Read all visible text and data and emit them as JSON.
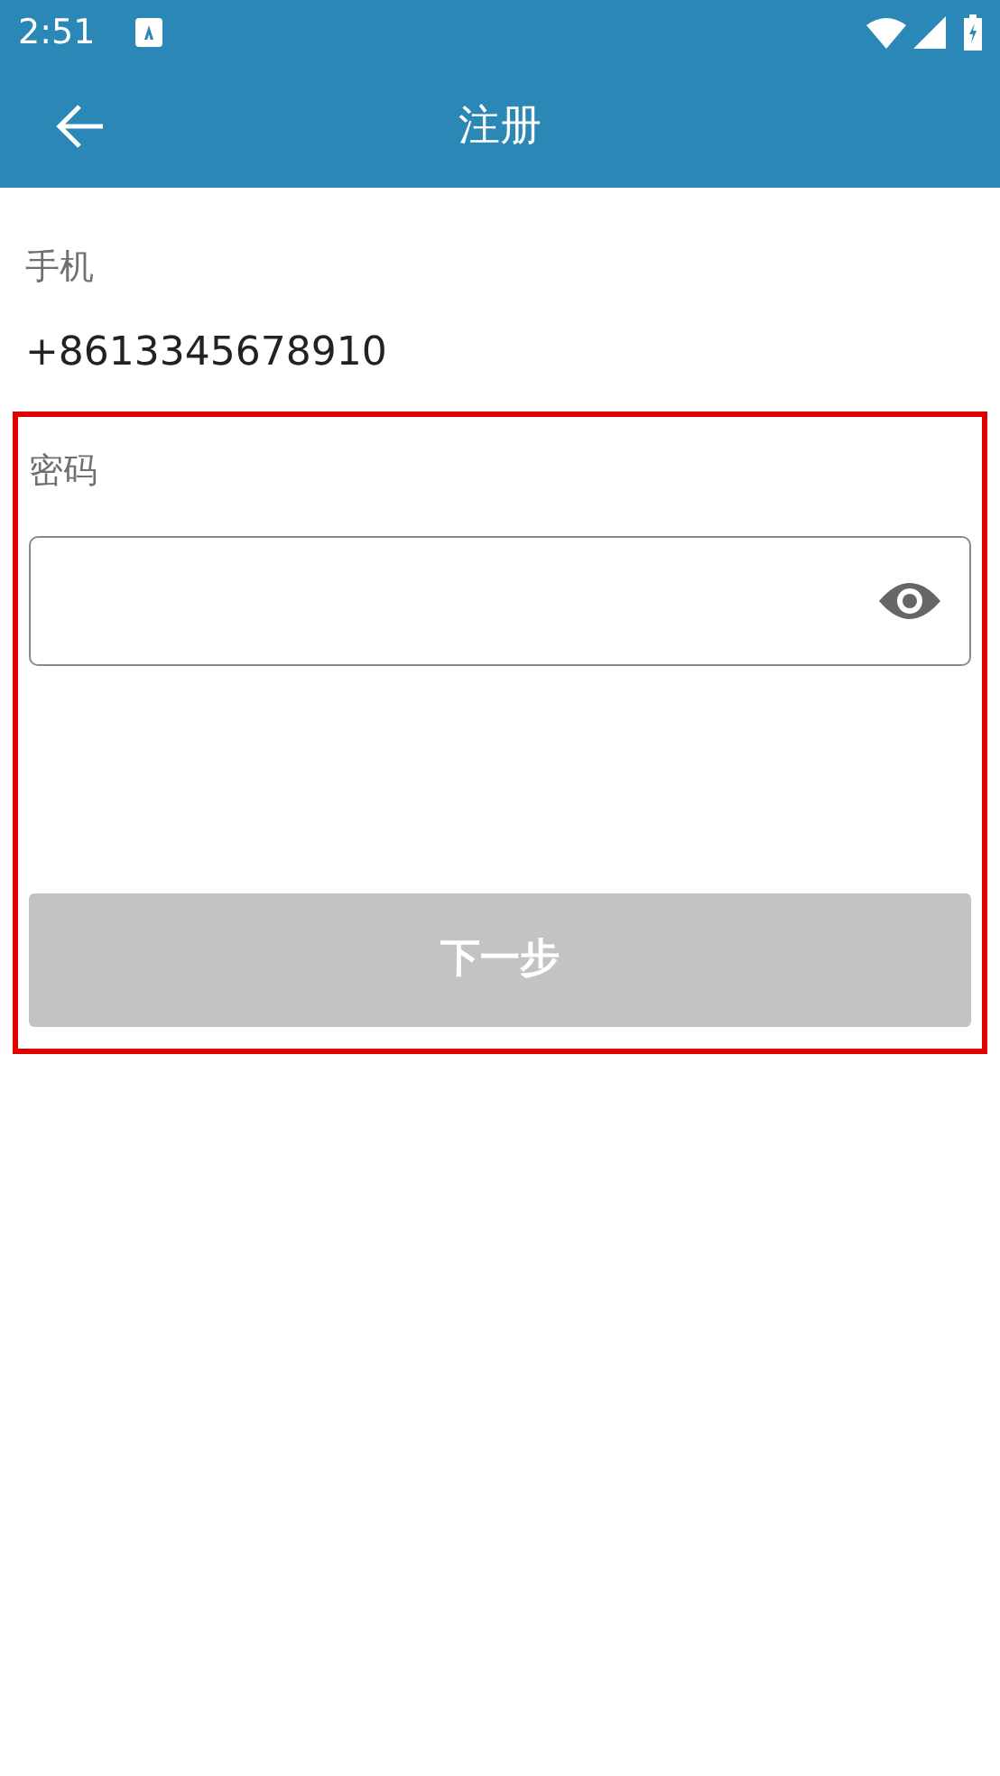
{
  "status_bar": {
    "time": "2:51"
  },
  "app_bar": {
    "title": "注册"
  },
  "phone": {
    "label": "手机",
    "value": "+8613345678910"
  },
  "password": {
    "label": "密码",
    "highlighted": true
  },
  "next_button": {
    "label": "下一步",
    "disabled": true
  }
}
